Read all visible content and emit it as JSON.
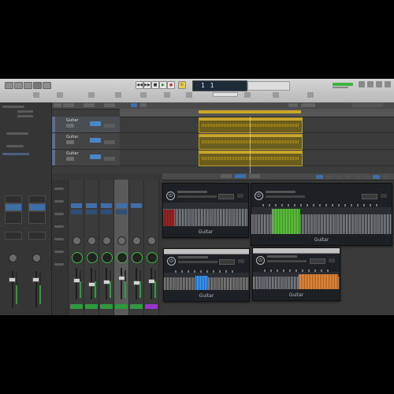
{
  "lcd": {
    "position": "1 1"
  },
  "tracks": [
    {
      "name": "Guitar"
    },
    {
      "name": "Guitar"
    },
    {
      "name": "Guitar"
    }
  ],
  "plugins": [
    {
      "label": "Guitar",
      "highlight_color": "#c81d1d"
    },
    {
      "label": "Guitar",
      "highlight_color": "#52c51f"
    },
    {
      "label": "Guitar",
      "highlight_color": "#3a8de0"
    },
    {
      "label": "Guitar",
      "highlight_color": "#e6801c"
    }
  ],
  "mixer": {
    "strip_name_colors": [
      "#2f9a3e",
      "#2f9a3e",
      "#2f9a3e",
      "#2f9a3e",
      "#2f9a3e",
      "#2f9a3e",
      "#9a35c9"
    ]
  },
  "colors": {
    "region": "#c9a626",
    "accent_blue": "#3f6ea8",
    "cpu_meter": "#3fb23f"
  },
  "icons": [
    "power-icon",
    "play-icon",
    "stop-icon",
    "record-icon",
    "rewind-icon",
    "forward-icon",
    "cycle-icon"
  ]
}
